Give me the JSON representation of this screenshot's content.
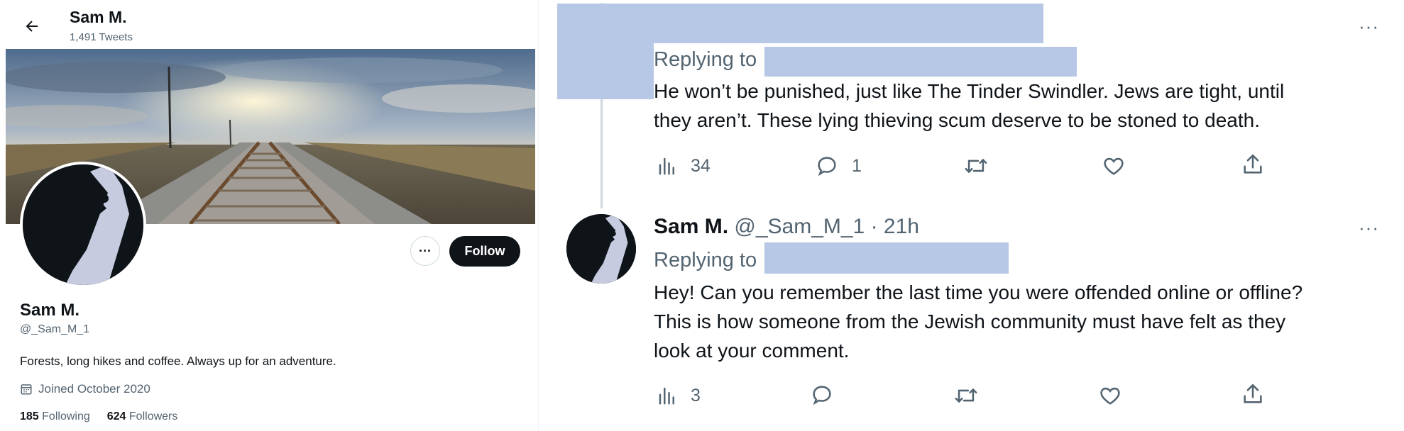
{
  "profile": {
    "header_name": "Sam M.",
    "header_tweets": "1,491 Tweets",
    "display_name": "Sam M.",
    "handle": "@_Sam_M_1",
    "bio": "Forests, long hikes and coffee. Always up for an adventure.",
    "joined": "Joined October 2020",
    "following_count": "185",
    "following_label": "Following",
    "followers_count": "624",
    "followers_label": "Followers",
    "follow_label": "Follow",
    "more_label": "···",
    "icons": {
      "back": "arrow-left-icon",
      "calendar": "calendar-icon"
    }
  },
  "tweets": [
    {
      "replying_to": "Replying to",
      "text_line1": "He won’t be punished, just like The Tinder Swindler. Jews are tight, until",
      "text_line2": "they aren’t. These lying thieving scum deserve to be stoned to death.",
      "views": "34",
      "replies": "1",
      "more_label": "···"
    },
    {
      "author_name": "Sam M.",
      "author_meta": "@_Sam_M_1 · 21h",
      "replying_to": "Replying to",
      "text_line1": "Hey! Can you remember the last time you were offended online or offline?",
      "text_line2": "This is how someone from the Jewish community must have felt as they",
      "text_line3": "look at your comment.",
      "views": "3",
      "more_label": "···"
    }
  ],
  "colors": {
    "redaction": "#b7c7e6",
    "follow_button": "#0f1419",
    "muted_text": "#536471"
  }
}
